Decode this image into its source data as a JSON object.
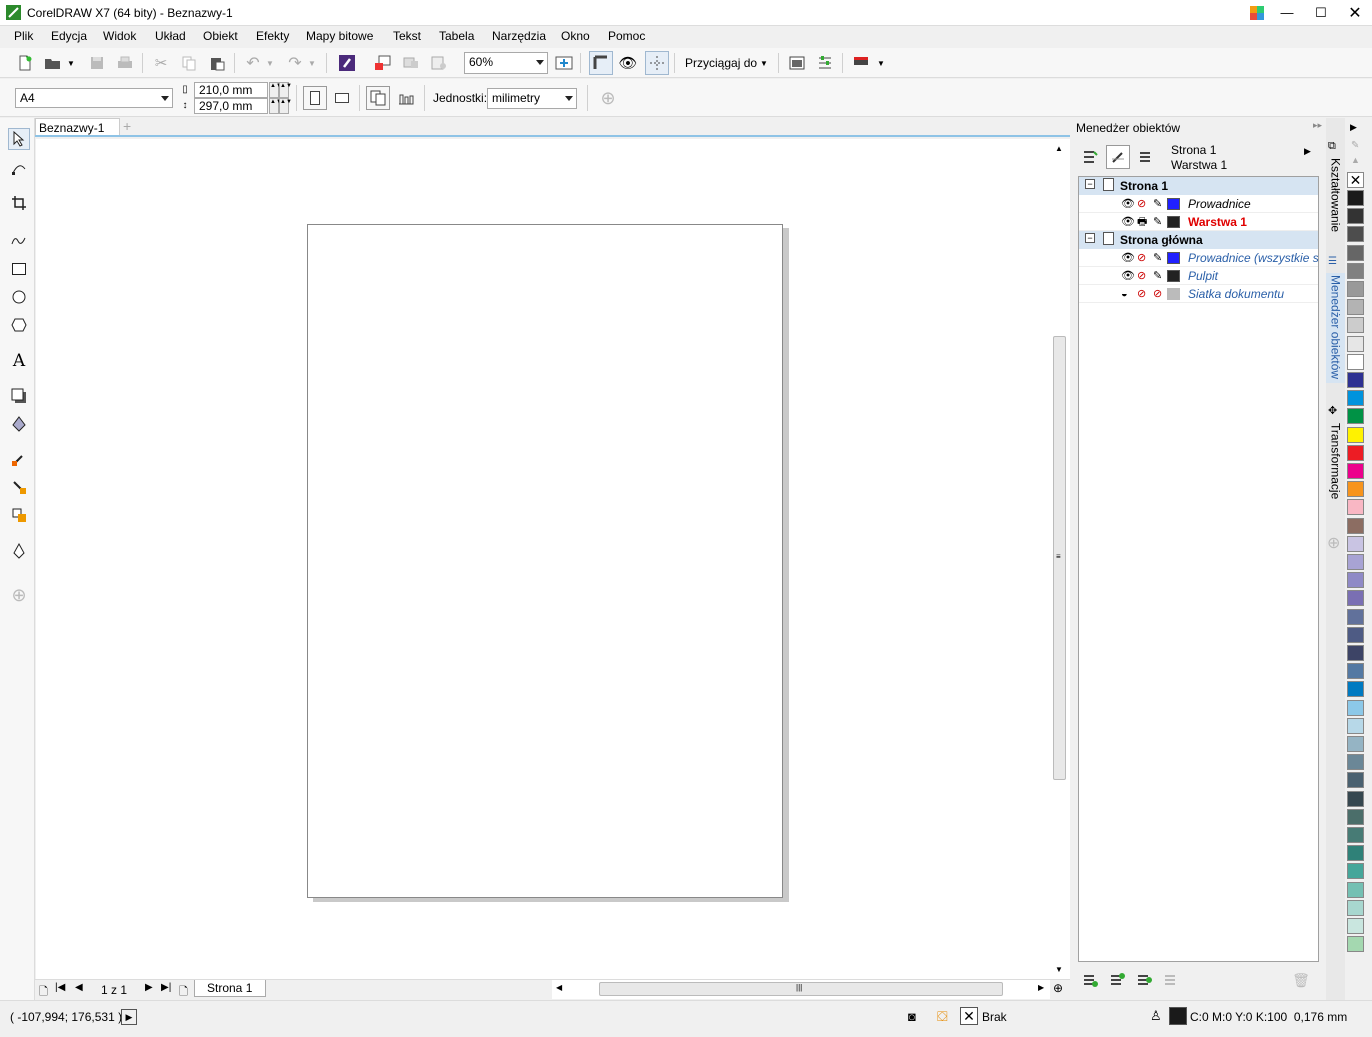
{
  "window": {
    "title": "CorelDRAW X7 (64 bity) - Beznazwy-1"
  },
  "menu": [
    "Plik",
    "Edycja",
    "Widok",
    "Układ",
    "Obiekt",
    "Efekty",
    "Mapy bitowe",
    "Tekst",
    "Tabela",
    "Narzędzia",
    "Okno",
    "Pomoc"
  ],
  "toolbar": {
    "zoom": "60%",
    "snap_label": "Przyciągaj do"
  },
  "propbar": {
    "paper": "A4",
    "width": "210,0 mm",
    "height": "297,0 mm",
    "units_label": "Jednostki:",
    "units_value": "milimetry"
  },
  "doc_tab": "Beznazwy-1",
  "page_nav": {
    "count": "1 z 1",
    "tab": "Strona 1"
  },
  "status": {
    "coords": "( -107,994; 176,531 )",
    "fill": "Brak",
    "outline": "C:0 M:0 Y:0 K:100  0,176 mm"
  },
  "docker": {
    "title": "Menedżer obiektów",
    "current_page": "Strona 1",
    "current_layer": "Warstwa 1",
    "tree": [
      {
        "type": "page",
        "label": "Strona 1"
      },
      {
        "type": "layer",
        "label": "Prowadnice",
        "color": "#2020ff",
        "style": "italic"
      },
      {
        "type": "layer",
        "label": "Warstwa 1",
        "color": "#222222",
        "style": "active"
      },
      {
        "type": "page",
        "label": "Strona główna"
      },
      {
        "type": "layer",
        "label": "Prowadnice (wszystkie st",
        "color": "#2020ff",
        "style": "master"
      },
      {
        "type": "layer",
        "label": "Pulpit",
        "color": "#222222",
        "style": "master"
      },
      {
        "type": "layer",
        "label": "Siatka dokumentu",
        "color": "#bbbbbb",
        "style": "master"
      }
    ]
  },
  "side_tabs": [
    "Kształtowanie",
    "Menedżer obiektów",
    "Transformacje"
  ],
  "palette": [
    "#1a1a1a",
    "#333333",
    "#4d4d4d",
    "#666666",
    "#808080",
    "#999999",
    "#b3b3b3",
    "#cccccc",
    "#e6e6e6",
    "#ffffff",
    "#2e3192",
    "#0093dd",
    "#009245",
    "#fff200",
    "#ed1c24",
    "#ec008c",
    "#f7941d",
    "#f9b7c4",
    "#8c6d62",
    "#c9c4e3",
    "#a8a3d4",
    "#8f89c6",
    "#7a6fb3",
    "#61719b",
    "#4e5b84",
    "#3d4466",
    "#5479a3",
    "#007ac1",
    "#8cc8e8",
    "#b7d8e8",
    "#95b4c4",
    "#6b8797",
    "#4a6170",
    "#36474f",
    "#4b6e6a",
    "#477b75",
    "#2f8178",
    "#45a69a",
    "#74c0b3",
    "#a8d7cf",
    "#c9e6df",
    "#a4d8b0"
  ]
}
